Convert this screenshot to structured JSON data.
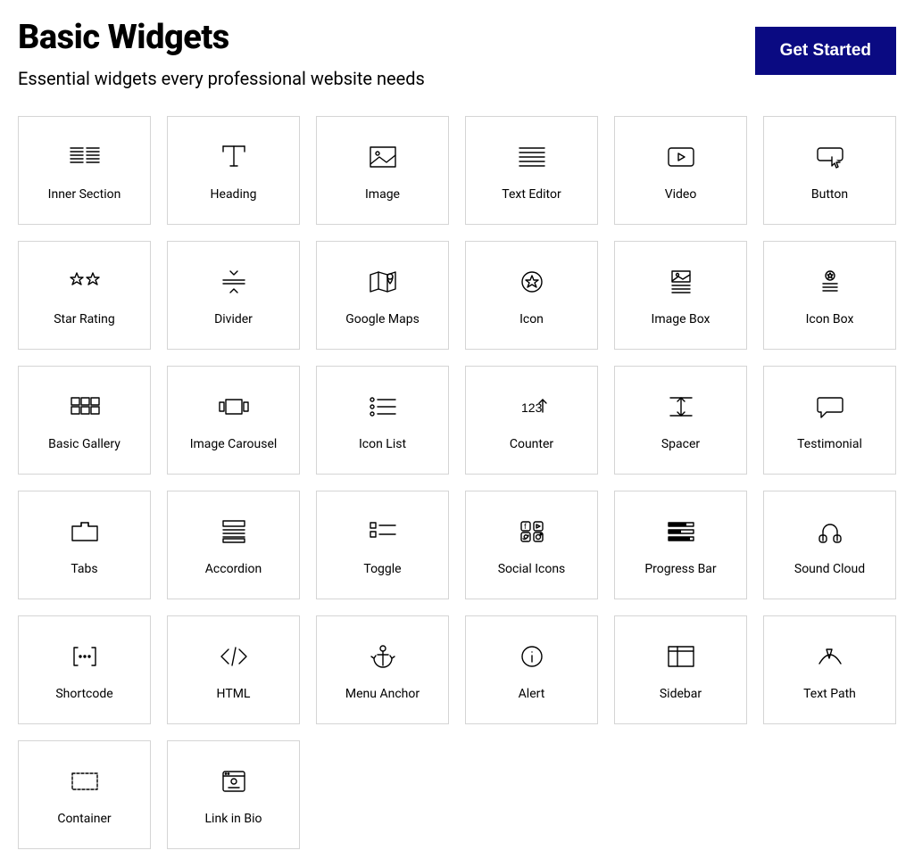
{
  "header": {
    "title": "Basic Widgets",
    "subtitle": "Essential widgets every professional website needs",
    "cta": "Get Started"
  },
  "widgets": [
    {
      "label": "Inner Section",
      "icon": "inner-section-icon"
    },
    {
      "label": "Heading",
      "icon": "heading-icon"
    },
    {
      "label": "Image",
      "icon": "image-icon"
    },
    {
      "label": "Text Editor",
      "icon": "text-editor-icon"
    },
    {
      "label": "Video",
      "icon": "video-icon"
    },
    {
      "label": "Button",
      "icon": "button-icon"
    },
    {
      "label": "Star Rating",
      "icon": "star-rating-icon"
    },
    {
      "label": "Divider",
      "icon": "divider-icon"
    },
    {
      "label": "Google Maps",
      "icon": "google-maps-icon"
    },
    {
      "label": "Icon",
      "icon": "icon-icon"
    },
    {
      "label": "Image Box",
      "icon": "image-box-icon"
    },
    {
      "label": "Icon Box",
      "icon": "icon-box-icon"
    },
    {
      "label": "Basic Gallery",
      "icon": "basic-gallery-icon"
    },
    {
      "label": "Image Carousel",
      "icon": "image-carousel-icon"
    },
    {
      "label": "Icon List",
      "icon": "icon-list-icon"
    },
    {
      "label": "Counter",
      "icon": "counter-icon"
    },
    {
      "label": "Spacer",
      "icon": "spacer-icon"
    },
    {
      "label": "Testimonial",
      "icon": "testimonial-icon"
    },
    {
      "label": "Tabs",
      "icon": "tabs-icon"
    },
    {
      "label": "Accordion",
      "icon": "accordion-icon"
    },
    {
      "label": "Toggle",
      "icon": "toggle-icon"
    },
    {
      "label": "Social Icons",
      "icon": "social-icons-icon"
    },
    {
      "label": "Progress Bar",
      "icon": "progress-bar-icon"
    },
    {
      "label": "Sound Cloud",
      "icon": "sound-cloud-icon"
    },
    {
      "label": "Shortcode",
      "icon": "shortcode-icon"
    },
    {
      "label": "HTML",
      "icon": "html-icon"
    },
    {
      "label": "Menu Anchor",
      "icon": "menu-anchor-icon"
    },
    {
      "label": "Alert",
      "icon": "alert-icon"
    },
    {
      "label": "Sidebar",
      "icon": "sidebar-icon"
    },
    {
      "label": "Text Path",
      "icon": "text-path-icon"
    },
    {
      "label": "Container",
      "icon": "container-icon"
    },
    {
      "label": "Link in Bio",
      "icon": "link-in-bio-icon"
    }
  ]
}
